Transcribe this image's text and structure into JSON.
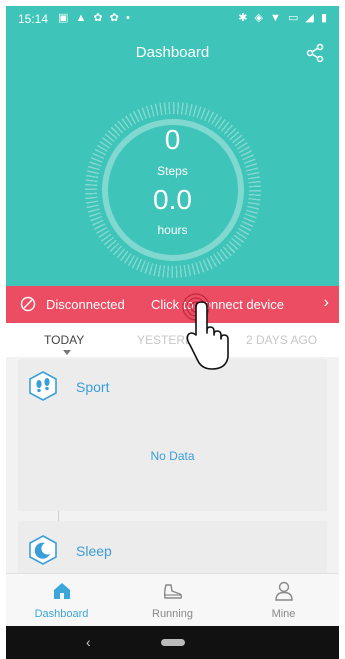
{
  "status_bar": {
    "time": "15:14",
    "left_icons": "▣ ▲ ✿ ✿ •",
    "right_icons": "✱ ◈ ▼ ▭ ◢ ▮"
  },
  "header": {
    "title": "Dashboard",
    "share_icon": "share-icon"
  },
  "summary": {
    "steps_value": "0",
    "steps_label": "Steps",
    "hours_value": "0.0",
    "hours_label": "hours"
  },
  "banner": {
    "status": "Disconnected",
    "action": "Click to connect device",
    "chevron": "›"
  },
  "day_tabs": [
    {
      "label": "TODAY",
      "active": true
    },
    {
      "label": "YESTERDAY",
      "active": false
    },
    {
      "label": "2 DAYS AGO",
      "active": false
    }
  ],
  "cards": {
    "sport": {
      "title": "Sport",
      "empty_text": "No Data"
    },
    "sleep": {
      "title": "Sleep"
    }
  },
  "bottom_nav": [
    {
      "label": "Dashboard",
      "icon": "home-icon",
      "active": true
    },
    {
      "label": "Running",
      "icon": "running-shoe-icon",
      "active": false
    },
    {
      "label": "Mine",
      "icon": "person-icon",
      "active": false
    }
  ],
  "system_nav": {
    "back": "‹"
  },
  "colors": {
    "primary": "#3ec4b8",
    "alert": "#ec4d63",
    "accent": "#3aa7d8"
  }
}
